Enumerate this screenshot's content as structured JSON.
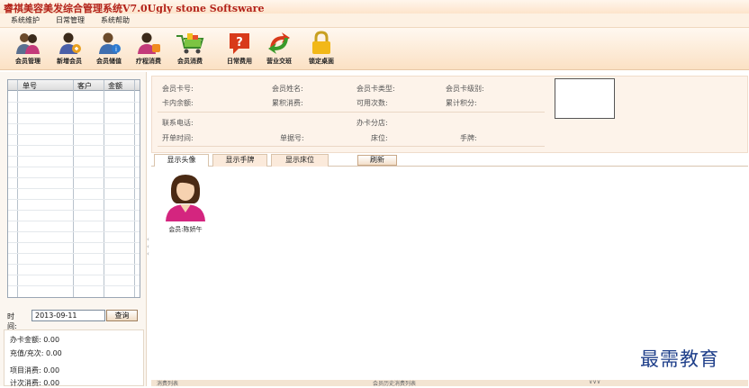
{
  "app": {
    "title": "睿祺美容美发综合管理系统V7.0Ugly  stone Softsware"
  },
  "menu": [
    {
      "label": "系统维护"
    },
    {
      "label": "日常管理"
    },
    {
      "label": "系统帮助"
    }
  ],
  "toolbar": [
    {
      "label": "会员管理",
      "icon": "members-icon"
    },
    {
      "label": "新增会员",
      "icon": "add-member-icon"
    },
    {
      "label": "会员储值",
      "icon": "member-deposit-icon"
    },
    {
      "label": "疗程消费",
      "icon": "treatment-icon"
    },
    {
      "label": "会员消费",
      "icon": "shopping-cart-icon"
    },
    {
      "label": "日常费用",
      "icon": "expense-icon"
    },
    {
      "label": "营业交班",
      "icon": "shift-handover-icon"
    },
    {
      "label": "锁定桌面",
      "icon": "lock-icon"
    }
  ],
  "orders": {
    "columns": [
      "单号",
      "客户",
      "金额"
    ],
    "rows": []
  },
  "filter": {
    "date_label": "时间:",
    "date_value": "2013-09-11",
    "query_label": "查询"
  },
  "summary": [
    {
      "label": "办卡金额:",
      "value": "0.00"
    },
    {
      "label": "充值/充次:",
      "value": "0.00"
    },
    {
      "label": "项目消费:",
      "value": "0.00"
    },
    {
      "label": "计次消费:",
      "value": "0.00"
    }
  ],
  "member_info": {
    "card_no": "会员卡号:",
    "name": "会员姓名:",
    "card_type": "会员卡类型:",
    "card_level": "会员卡级别:",
    "balance": "卡内余额:",
    "total_spent": "累积消费:",
    "usable_times": "可用次数:",
    "total_points": "累计积分:",
    "phone": "联系电话:",
    "branch": "办卡分店:",
    "open_time": "开单时间:",
    "bill_no": "单据号:",
    "bed": "床位:",
    "wristband": "手牌:"
  },
  "tabs": [
    {
      "label": "显示头像",
      "active": true
    },
    {
      "label": "显示手牌",
      "active": false
    },
    {
      "label": "显示床位",
      "active": false
    }
  ],
  "refresh_label": "刷新",
  "members": [
    {
      "label": "会员:陈娇午"
    }
  ],
  "bottom": {
    "left": "消费列表",
    "middle": "会员历史消费列表",
    "right": "∨∨∨"
  },
  "watermark": "最需教育",
  "colors": {
    "title": "#b3231a",
    "toolbar_bg": "#fbe1c4",
    "watermark": "#1f3f8a"
  }
}
